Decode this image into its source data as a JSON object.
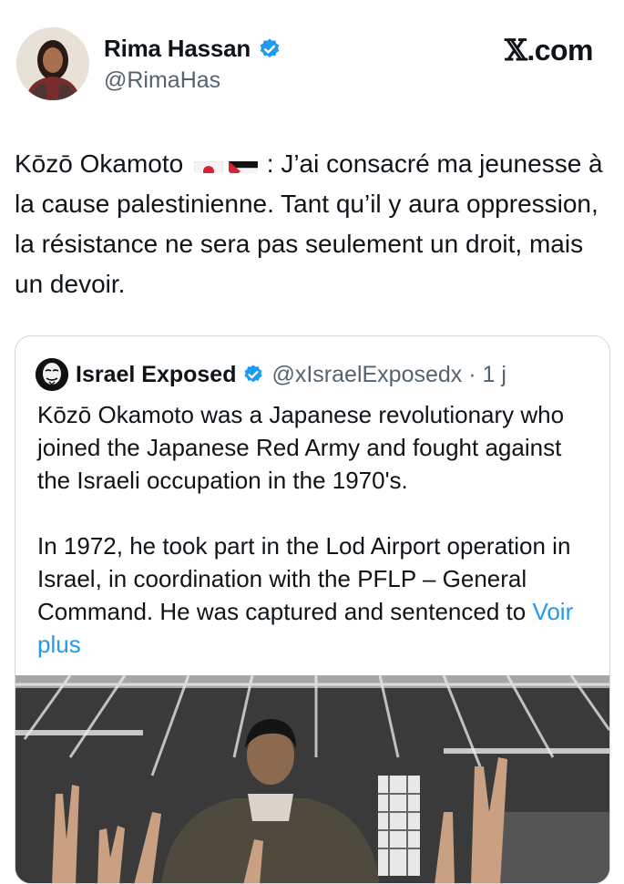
{
  "author": {
    "name": "Rima Hassan",
    "handle": "@RimaHas"
  },
  "site": {
    "x_glyph": "𝕏",
    "label": ".com"
  },
  "post": {
    "before_flags": "Kōzō Okamoto",
    "after_flags": " : J’ai consacré ma jeunesse à la cause palestinienne. Tant qu’il y aura oppression, la résistance ne sera pas seulement un droit, mais un devoir."
  },
  "quoted": {
    "name": "Israel Exposed",
    "handle": "@xIsraelExposedx · 1 j",
    "paragraph1": "Kōzō Okamoto was a Japanese revolutionary who joined the Japanese Red Army and fought against the Israeli occupation in the 1970's.",
    "paragraph2": "In 1972, he took part in the Lod Airport operation in Israel, in coordination with the PFLP – General Command. He was captured and sentenced to ",
    "more_link": "Voir plus"
  },
  "colors": {
    "accent": "#1d9bf0",
    "text": "#0f1419",
    "muted": "#536471",
    "border": "#cfd9de"
  }
}
